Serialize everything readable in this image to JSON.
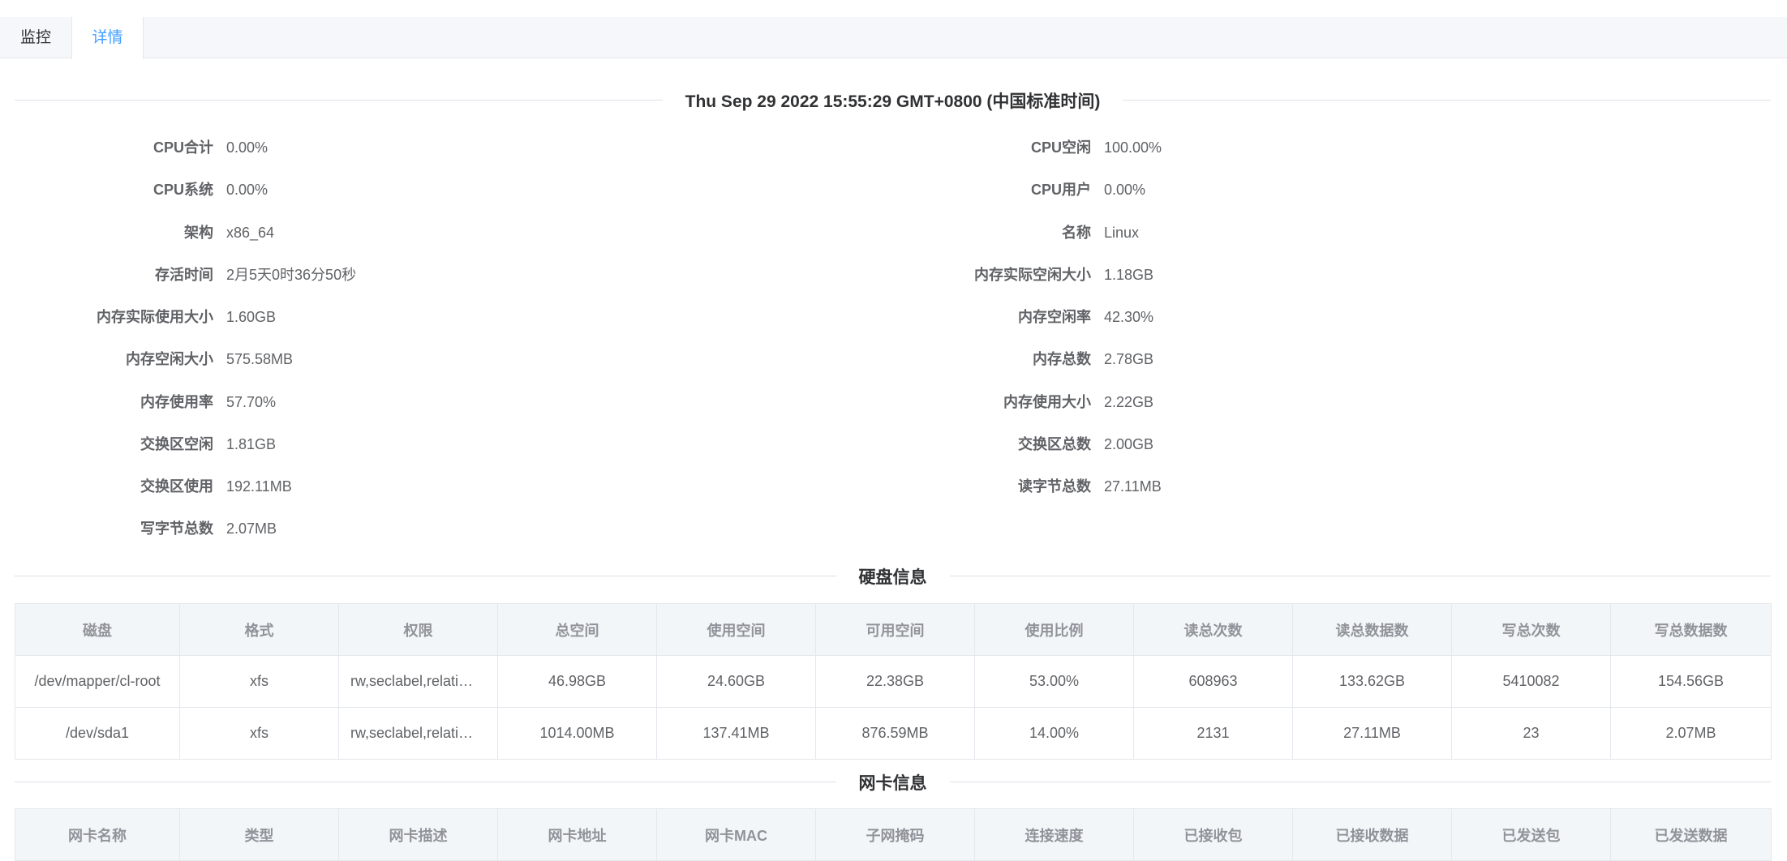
{
  "tabs": [
    {
      "label": "监控",
      "active": false
    },
    {
      "label": "详情",
      "active": true
    }
  ],
  "timestamp": "Thu Sep 29 2022 15:55:29 GMT+0800 (中国标准时间)",
  "details_left": [
    {
      "label": "CPU合计",
      "value": "0.00%"
    },
    {
      "label": "CPU系统",
      "value": "0.00%"
    },
    {
      "label": "架构",
      "value": "x86_64"
    },
    {
      "label": "存活时间",
      "value": "2月5天0时36分50秒"
    },
    {
      "label": "内存实际使用大小",
      "value": "1.60GB"
    },
    {
      "label": "内存空闲大小",
      "value": "575.58MB"
    },
    {
      "label": "内存使用率",
      "value": "57.70%"
    },
    {
      "label": "交换区空闲",
      "value": "1.81GB"
    },
    {
      "label": "交换区使用",
      "value": "192.11MB"
    },
    {
      "label": "写字节总数",
      "value": "2.07MB"
    }
  ],
  "details_right": [
    {
      "label": "CPU空闲",
      "value": "100.00%"
    },
    {
      "label": "CPU用户",
      "value": "0.00%"
    },
    {
      "label": "名称",
      "value": "Linux"
    },
    {
      "label": "内存实际空闲大小",
      "value": "1.18GB"
    },
    {
      "label": "内存空闲率",
      "value": "42.30%"
    },
    {
      "label": "内存总数",
      "value": "2.78GB"
    },
    {
      "label": "内存使用大小",
      "value": "2.22GB"
    },
    {
      "label": "交换区总数",
      "value": "2.00GB"
    },
    {
      "label": "读字节总数",
      "value": "27.11MB"
    }
  ],
  "disk": {
    "title": "硬盘信息",
    "columns": [
      "磁盘",
      "格式",
      "权限",
      "总空间",
      "使用空间",
      "可用空间",
      "使用比例",
      "读总次数",
      "读总数据数",
      "写总次数",
      "写总数据数"
    ],
    "rows": [
      [
        "/dev/mapper/cl-root",
        "xfs",
        "rw,seclabel,relati…",
        "46.98GB",
        "24.60GB",
        "22.38GB",
        "53.00%",
        "608963",
        "133.62GB",
        "5410082",
        "154.56GB"
      ],
      [
        "/dev/sda1",
        "xfs",
        "rw,seclabel,relati…",
        "1014.00MB",
        "137.41MB",
        "876.59MB",
        "14.00%",
        "2131",
        "27.11MB",
        "23",
        "2.07MB"
      ]
    ]
  },
  "network": {
    "title": "网卡信息",
    "columns": [
      "网卡名称",
      "类型",
      "网卡描述",
      "网卡地址",
      "网卡MAC",
      "子网掩码",
      "连接速度",
      "已接收包",
      "已接收数据",
      "已发送包",
      "已发送数据"
    ]
  },
  "colors": {
    "accent": "#409eff",
    "border": "#e4e7ed",
    "header_bg": "#f3f6f9"
  }
}
